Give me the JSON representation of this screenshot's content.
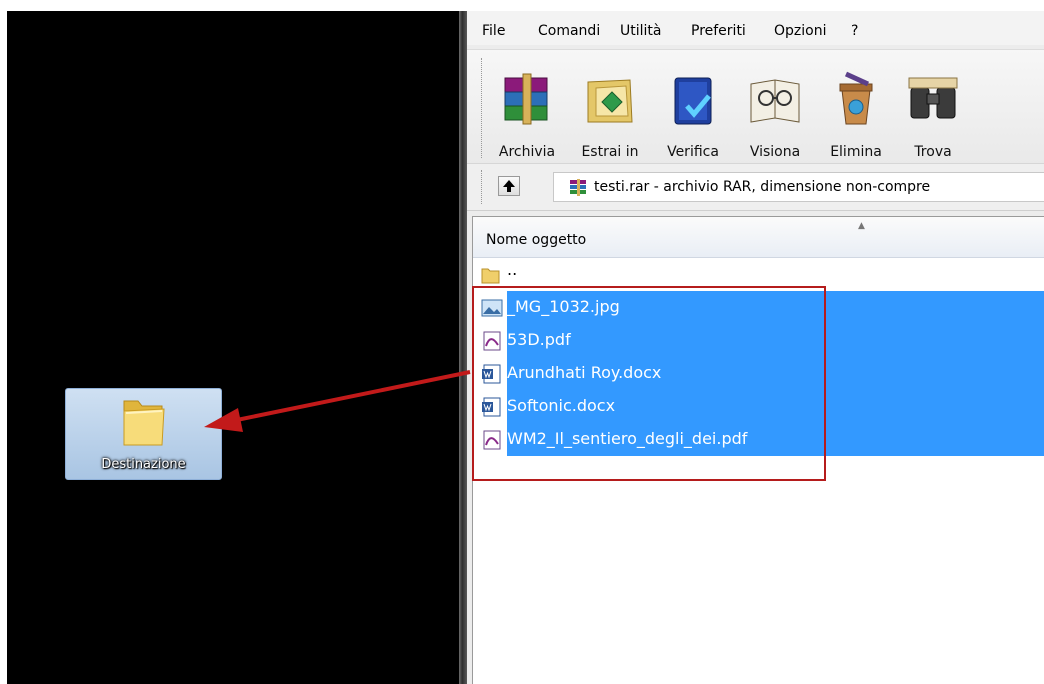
{
  "menu": [
    "File",
    "Comandi",
    "Utilità",
    "Preferiti",
    "Opzioni",
    "?"
  ],
  "toolbar": [
    {
      "label": "Archivia",
      "icon": "archive-books-icon"
    },
    {
      "label": "Estrai in",
      "icon": "extract-folder-icon"
    },
    {
      "label": "Verifica",
      "icon": "verify-book-icon"
    },
    {
      "label": "Visiona",
      "icon": "view-book-icon"
    },
    {
      "label": "Elimina",
      "icon": "delete-bin-icon"
    },
    {
      "label": "Trova",
      "icon": "binoculars-icon"
    }
  ],
  "address": {
    "text": "testi.rar - archivio RAR, dimensione non-compre"
  },
  "list": {
    "column_header": "Nome oggetto",
    "parent": "..",
    "files": [
      {
        "name": "_MG_1032.jpg",
        "type": "image",
        "selected": true
      },
      {
        "name": "53D.pdf",
        "type": "pdf",
        "selected": true
      },
      {
        "name": "Arundhati Roy.docx",
        "type": "docx",
        "selected": true
      },
      {
        "name": "Softonic.docx",
        "type": "docx",
        "selected": true
      },
      {
        "name": "WM2_Il_sentiero_degli_dei.pdf",
        "type": "pdf",
        "selected": true
      }
    ]
  },
  "desktop": {
    "folder_label": "Destinazione"
  },
  "colors": {
    "selection": "#3399ff",
    "annotation": "#b51c1c",
    "desktop": "#000000"
  }
}
